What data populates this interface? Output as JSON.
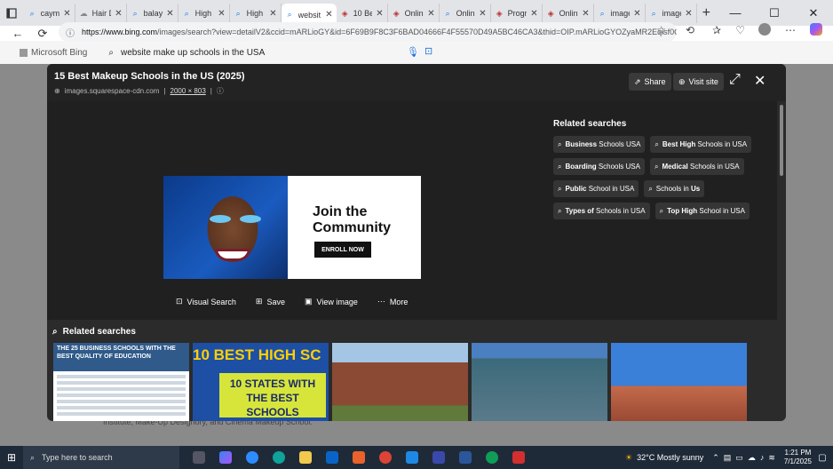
{
  "browser": {
    "tabs": [
      {
        "title": "cayma",
        "icon": "search-icon"
      },
      {
        "title": "Hair D",
        "icon": "cloud-icon"
      },
      {
        "title": "balaya",
        "icon": "search-icon"
      },
      {
        "title": "High s",
        "icon": "search-icon"
      },
      {
        "title": "High s",
        "icon": "search-icon"
      },
      {
        "title": "websit",
        "icon": "search-icon",
        "active": true
      },
      {
        "title": "10 Be",
        "icon": "badge-icon"
      },
      {
        "title": "Online",
        "icon": "badge-icon"
      },
      {
        "title": "Online",
        "icon": "search-icon"
      },
      {
        "title": "Progra",
        "icon": "badge-icon"
      },
      {
        "title": "Online",
        "icon": "badge-icon"
      },
      {
        "title": "image",
        "icon": "search-icon"
      },
      {
        "title": "image",
        "icon": "search-icon"
      }
    ],
    "url_host": "https://www.bing.com",
    "url_path": "/images/search?view=detailV2&ccid=mARLioGY&id=6F69B9F8C3F6BAD04666F4F55570D49A5BC46CA3&thid=OIP.mARLioGYOZyaMR2Eqisf0QH..."
  },
  "bing": {
    "logo": "Microsoft Bing",
    "query": "website make up schools in the USA",
    "background_text": "Institute, Make-Up Designory, and Cinema Makeup School."
  },
  "modal": {
    "title": "15 Best Makeup Schools in the US (2025)",
    "source": "images.squarespace-cdn.com",
    "dimensions": "2000 × 803",
    "share_label": "Share",
    "visit_label": "Visit site",
    "ad": {
      "headline1": "Join the",
      "headline2": "Community",
      "cta": "ENROLL NOW"
    },
    "related_title": "Related searches",
    "chips": [
      {
        "bold": "Business",
        "rest": " Schools USA"
      },
      {
        "bold": "Best High",
        "rest": " Schools in USA"
      },
      {
        "bold": "Boarding",
        "rest": " Schools USA"
      },
      {
        "bold": "Medical",
        "rest": " Schools in USA"
      },
      {
        "bold": "Public",
        "rest": " School in USA"
      },
      {
        "bold": "",
        "rest": "Schools in ",
        "bold2": "Us"
      },
      {
        "bold": "Types of",
        "rest": " Schools in USA"
      },
      {
        "bold": "Top High",
        "rest": " School in USA"
      }
    ],
    "actions": {
      "visual_search": "Visual Search",
      "save": "Save",
      "view_image": "View image",
      "more": "More"
    },
    "bottom_related_title": "Related searches",
    "thumb1_caption": "THE 25 BUSINESS SCHOOLS WITH THE BEST QUALITY OF EDUCATION",
    "thumb2_big": "10 BEST HIGH SC",
    "thumb2_sticker": "10 STATES WITH THE BEST SCHOOLS"
  },
  "taskbar": {
    "search_placeholder": "Type here to search",
    "weather": "32°C  Mostly sunny",
    "time": "1:21 PM",
    "date": "7/1/2025"
  },
  "colors": {
    "accent": "#1a73e8",
    "modal_bg": "#2b2b2b",
    "taskbar": "#1f2a38"
  }
}
